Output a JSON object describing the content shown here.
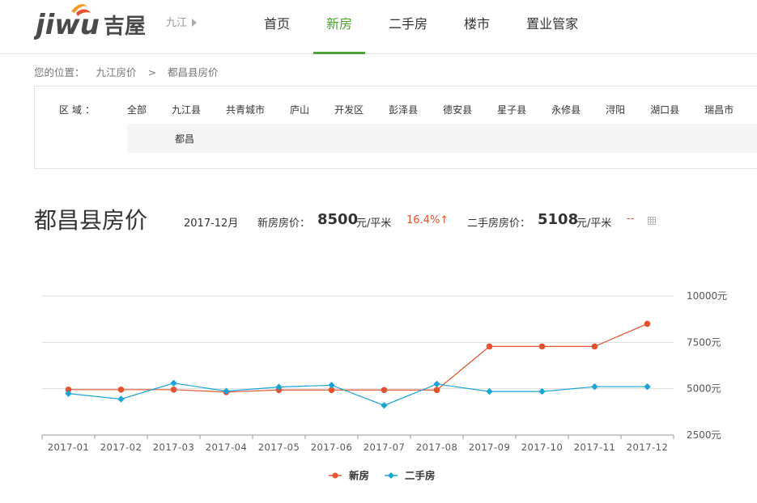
{
  "header": {
    "logo_text": "jiwu吉屋",
    "city": "九江",
    "nav": [
      {
        "label": "首页",
        "active": false
      },
      {
        "label": "新房",
        "active": true
      },
      {
        "label": "二手房",
        "active": false
      },
      {
        "label": "楼市",
        "active": false
      },
      {
        "label": "置业管家",
        "active": false
      }
    ]
  },
  "breadcrumb": {
    "prefix": "您的位置：",
    "items": [
      "九江房价",
      ">",
      "都昌县房价"
    ]
  },
  "filter": {
    "label": "区域：",
    "options": [
      "全部",
      "九江县",
      "共青城市",
      "庐山",
      "开发区",
      "彭泽县",
      "德安县",
      "星子县",
      "永修县",
      "浔阳",
      "湖口县",
      "瑞昌市",
      "都"
    ],
    "sub_options": [
      "都昌"
    ]
  },
  "price_header": {
    "title": "都昌县房价",
    "month": "2017-12月",
    "new_label": "新房房价：",
    "new_value": "8500",
    "new_unit": "元/平米",
    "new_change": "16.4%↑",
    "sh_label": "二手房房价：",
    "sh_value": "5108",
    "sh_unit": "元/平米",
    "sh_change": "--"
  },
  "colors": {
    "accent_green": "#4aa631",
    "new_series": "#e4532d",
    "sh_series": "#1ba3d6"
  },
  "chart_data": {
    "type": "line",
    "categories": [
      "2017-01",
      "2017-02",
      "2017-03",
      "2017-04",
      "2017-05",
      "2017-06",
      "2017-07",
      "2017-08",
      "2017-09",
      "2017-10",
      "2017-11",
      "2017-12"
    ],
    "series": [
      {
        "name": "新房",
        "values": [
          4950,
          4950,
          4950,
          4820,
          4930,
          4930,
          4930,
          4930,
          7280,
          7280,
          7280,
          8500
        ]
      },
      {
        "name": "二手房",
        "values": [
          4740,
          4440,
          5300,
          4870,
          5090,
          5190,
          4100,
          5250,
          4850,
          4850,
          5108,
          5108
        ]
      }
    ],
    "y_ticks": [
      "10000元",
      "7500元",
      "5000元",
      "2500元"
    ],
    "ylim": [
      2500,
      10000
    ],
    "grid": true,
    "legend": "bottom"
  }
}
